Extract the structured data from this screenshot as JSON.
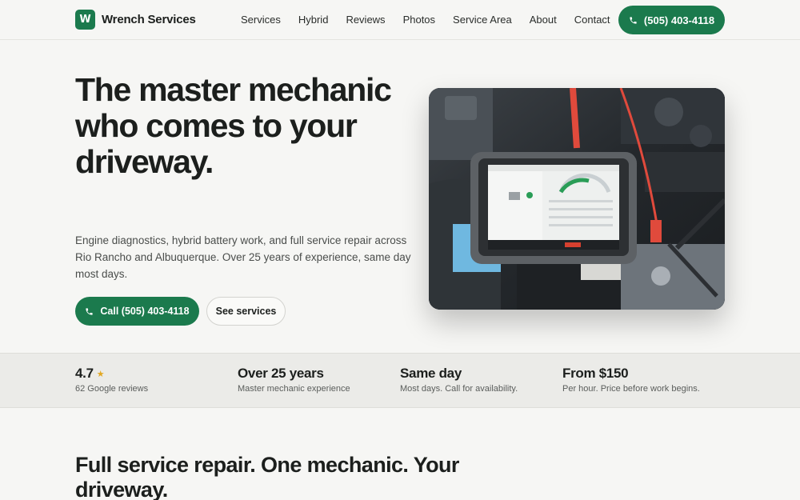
{
  "brand": {
    "logo_letter": "W",
    "name": "Wrench Services",
    "accent": "#1b7a4d"
  },
  "nav": [
    "Services",
    "Hybrid",
    "Reviews",
    "Photos",
    "Service Area",
    "About",
    "Contact"
  ],
  "header_cta": {
    "label": "(505) 403-4118",
    "icon": "phone-icon"
  },
  "hero": {
    "title": "The master mechanic who comes to your driveway.",
    "subtitle": "Engine diagnostics, hybrid battery work, and full service repair across Rio Rancho and Albuquerque. Over 25 years of experience, same day most days.",
    "primary_button": "Call (505) 403-4118",
    "secondary_button": "See services"
  },
  "stats": [
    {
      "value": "4.7",
      "label": "62 Google reviews",
      "star": "★"
    },
    {
      "value": "Over 25 years",
      "label": "Master mechanic experience"
    },
    {
      "value": "Same day",
      "label": "Most days. Call for availability."
    },
    {
      "value": "From $150",
      "label": "Per hour. Price before work begins."
    }
  ],
  "section": {
    "title": "Full service repair. One mechanic. Your driveway."
  }
}
